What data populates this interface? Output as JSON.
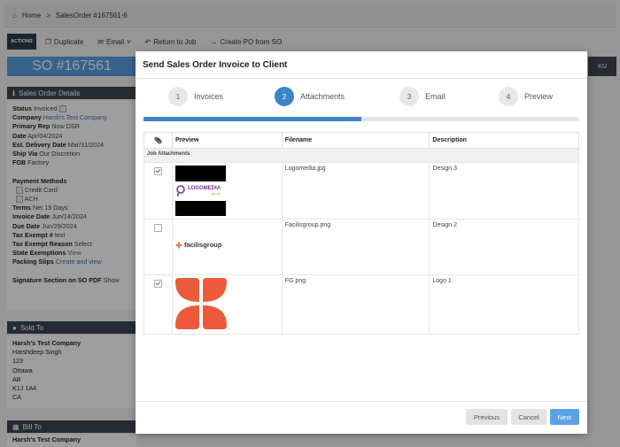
{
  "breadcrumb": {
    "home": "Home",
    "separator": ">",
    "current": "SalesOrder #167561-6"
  },
  "toolbar": {
    "actions_label": "ACTIONS",
    "duplicate": "Duplicate",
    "email": "Email",
    "return_to_job": "Return to Job",
    "create_po": "Create PO from SO"
  },
  "so_header": {
    "title": "SO #167561",
    "right_label": "KU"
  },
  "details": {
    "heading": "Sales Order Details",
    "status_label": "Status",
    "status_value": "Invoiced",
    "company_label": "Company",
    "company_value": "Harsh's Test Company",
    "primary_rep_label": "Primary Rep",
    "primary_rep_value": "Now DSR",
    "date_label": "Date",
    "date_value": "Apr/04/2024",
    "est_delivery_label": "Est. Delivery Date",
    "est_delivery_value": "Mar/31/2024",
    "ship_via_label": "Ship Via",
    "ship_via_value": "Our Discretion",
    "fob_label": "FOB",
    "fob_value": "Factory",
    "payment_methods_label": "Payment Methods",
    "payment_methods": [
      "Credit Card",
      "ACH"
    ],
    "terms_label": "Terms",
    "terms_value": "Net 15 Days",
    "invoice_date_label": "Invoice Date",
    "invoice_date_value": "Jun/14/2024",
    "due_date_label": "Due Date",
    "due_date_value": "Jun/29/2024",
    "tax_exempt_label": "Tax Exempt #",
    "tax_exempt_value": "test",
    "tax_exempt_reason_label": "Tax Exempt Reason",
    "tax_exempt_reason_value": "Select",
    "state_exemptions_label": "State Exemptions",
    "state_exemptions_link": "View",
    "packing_slips_label": "Packing Slips",
    "packing_slips_link": "Create and view",
    "signature_label": "Signature Section on SO PDF",
    "signature_value": "Show"
  },
  "sold_to": {
    "heading": "Sold To",
    "company": "Harsh's Test Company",
    "name": "Harshdeep Singh",
    "street": "123",
    "city": "Ottawa",
    "province": "AB",
    "postal": "K1J 1A4",
    "country": "CA"
  },
  "bill_to": {
    "heading": "Bill To",
    "company": "Harsh's Test Company"
  },
  "modal": {
    "title": "Send Sales Order Invoice to Client",
    "steps": [
      {
        "num": "1",
        "label": "Invoices"
      },
      {
        "num": "2",
        "label": "Attachments"
      },
      {
        "num": "3",
        "label": "Email"
      },
      {
        "num": "4",
        "label": "Preview"
      }
    ],
    "active_step": 2,
    "progress": 0.5,
    "table": {
      "col_icon": "paperclip-icon",
      "col_preview": "Preview",
      "col_filename": "Filename",
      "col_description": "Description",
      "group": "Job Attachments",
      "rows": [
        {
          "checked": true,
          "filename": "Logomedia.jpg",
          "description": "Design 3",
          "logo_text": "LOGOMEDIA",
          "logo_sub": "group"
        },
        {
          "checked": false,
          "filename": "Facilisgroup.png",
          "description": "Design 2",
          "logo_text": "facilisgroup"
        },
        {
          "checked": true,
          "filename": "FG.png",
          "description": "Logo 1"
        }
      ]
    },
    "buttons": {
      "previous": "Previous",
      "cancel": "Cancel",
      "next": "Next"
    }
  },
  "colors": {
    "accent": "#3a85c8",
    "next_button": "#5aa2e6",
    "facilis_orange": "#ec5a3c",
    "logomedia_purple": "#7b2e8f",
    "logomedia_green": "#8dbf3f"
  }
}
